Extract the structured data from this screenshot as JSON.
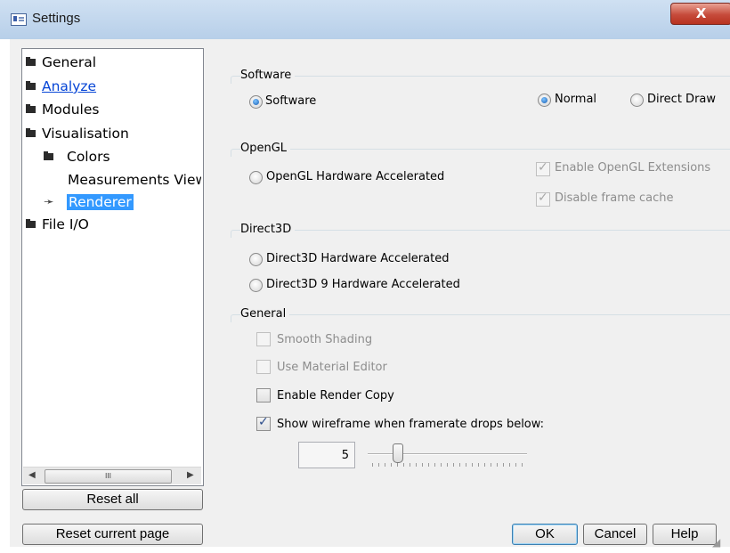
{
  "window": {
    "title": "Settings",
    "close_label": "X"
  },
  "tree": {
    "items": [
      {
        "label": "General"
      },
      {
        "label": "Analyze"
      },
      {
        "label": "Modules"
      },
      {
        "label": "Visualisation"
      },
      {
        "label": "Colors"
      },
      {
        "label": "Measurements View"
      },
      {
        "label": "Renderer"
      },
      {
        "label": "File I/O"
      }
    ],
    "scroll_thumb": "III"
  },
  "buttons": {
    "reset_all": "Reset all",
    "reset_page": "Reset current page",
    "ok": "OK",
    "cancel": "Cancel",
    "help": "Help"
  },
  "software": {
    "title": "Software",
    "software_label": "Software",
    "normal_label": "Normal",
    "directdraw_label": "Direct Draw",
    "software_selected": true,
    "normal_selected": true
  },
  "opengl": {
    "title": "OpenGL",
    "hw_label": "OpenGL Hardware Accelerated",
    "ext_label": "Enable OpenGL Extensions",
    "cache_label": "Disable frame cache",
    "ext_checked": true,
    "cache_checked": true
  },
  "direct3d": {
    "title": "Direct3D",
    "hw_label": "Direct3D Hardware Accelerated",
    "hw9_label": "Direct3D 9 Hardware Accelerated"
  },
  "general": {
    "title": "General",
    "smooth_label": "Smooth Shading",
    "material_label": "Use Material Editor",
    "rendercopy_label": "Enable Render Copy",
    "wireframe_label": "Show wireframe when framerate drops below:",
    "wireframe_checked": true,
    "framerate_value": "5"
  }
}
